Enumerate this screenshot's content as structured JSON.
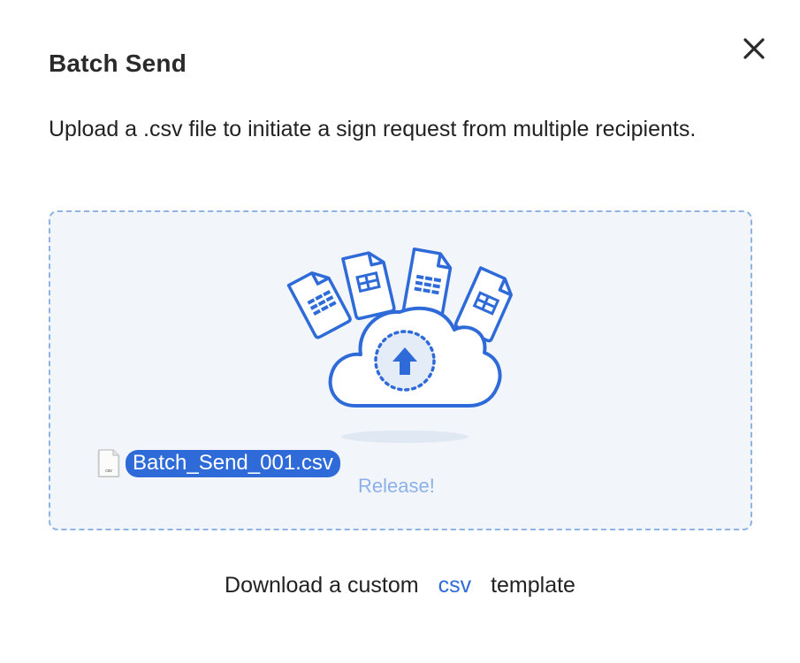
{
  "modal": {
    "title": "Batch Send",
    "description": "Upload a .csv file to initiate a sign request from multiple recipients."
  },
  "dropzone": {
    "drag_file_name": "Batch_Send_001.csv",
    "drag_file_icon_label": "csv",
    "release_label": "Release!"
  },
  "footer": {
    "prefix": "Download a custom",
    "link": "csv",
    "suffix": "template"
  },
  "colors": {
    "accent": "#2f6bd8",
    "dropzone_border": "#8fb3e3",
    "dropzone_bg": "#f2f5fa",
    "release_text": "#8cb1e8"
  },
  "icons": {
    "close": "close-icon",
    "upload": "cloud-upload-icon",
    "file": "csv-file-icon"
  }
}
